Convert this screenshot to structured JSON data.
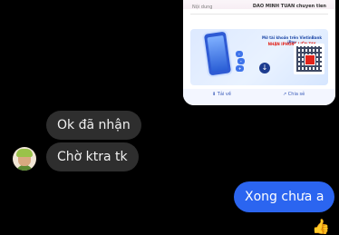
{
  "receipt": {
    "content_label": "Nội dung",
    "content_value": "DAO MINH TUAN chuyen tien"
  },
  "promo": {
    "title": "Mở tài khoản trên VietinBank iPay",
    "subtitle": "NHẬN IPHONE LIỀN TAY",
    "tags": [
      "-",
      "-",
      "+"
    ]
  },
  "share_bar": {
    "save_label": "Tải về",
    "share_label": "Chia sẻ"
  },
  "messages": [
    {
      "text": "Ok đã nhận",
      "direction": "incoming"
    },
    {
      "text": "Chờ ktra tk",
      "direction": "incoming"
    },
    {
      "text": "Xong chưa a",
      "direction": "outgoing"
    }
  ],
  "colors": {
    "background": "#000000",
    "incoming_bubble": "#2e2e2e",
    "outgoing_bubble": "#2b65f0",
    "like_icon": "#3a7bf6"
  },
  "icons": {
    "like": "thumbs-up-icon",
    "promo_arrow": "arrow-down-icon"
  }
}
